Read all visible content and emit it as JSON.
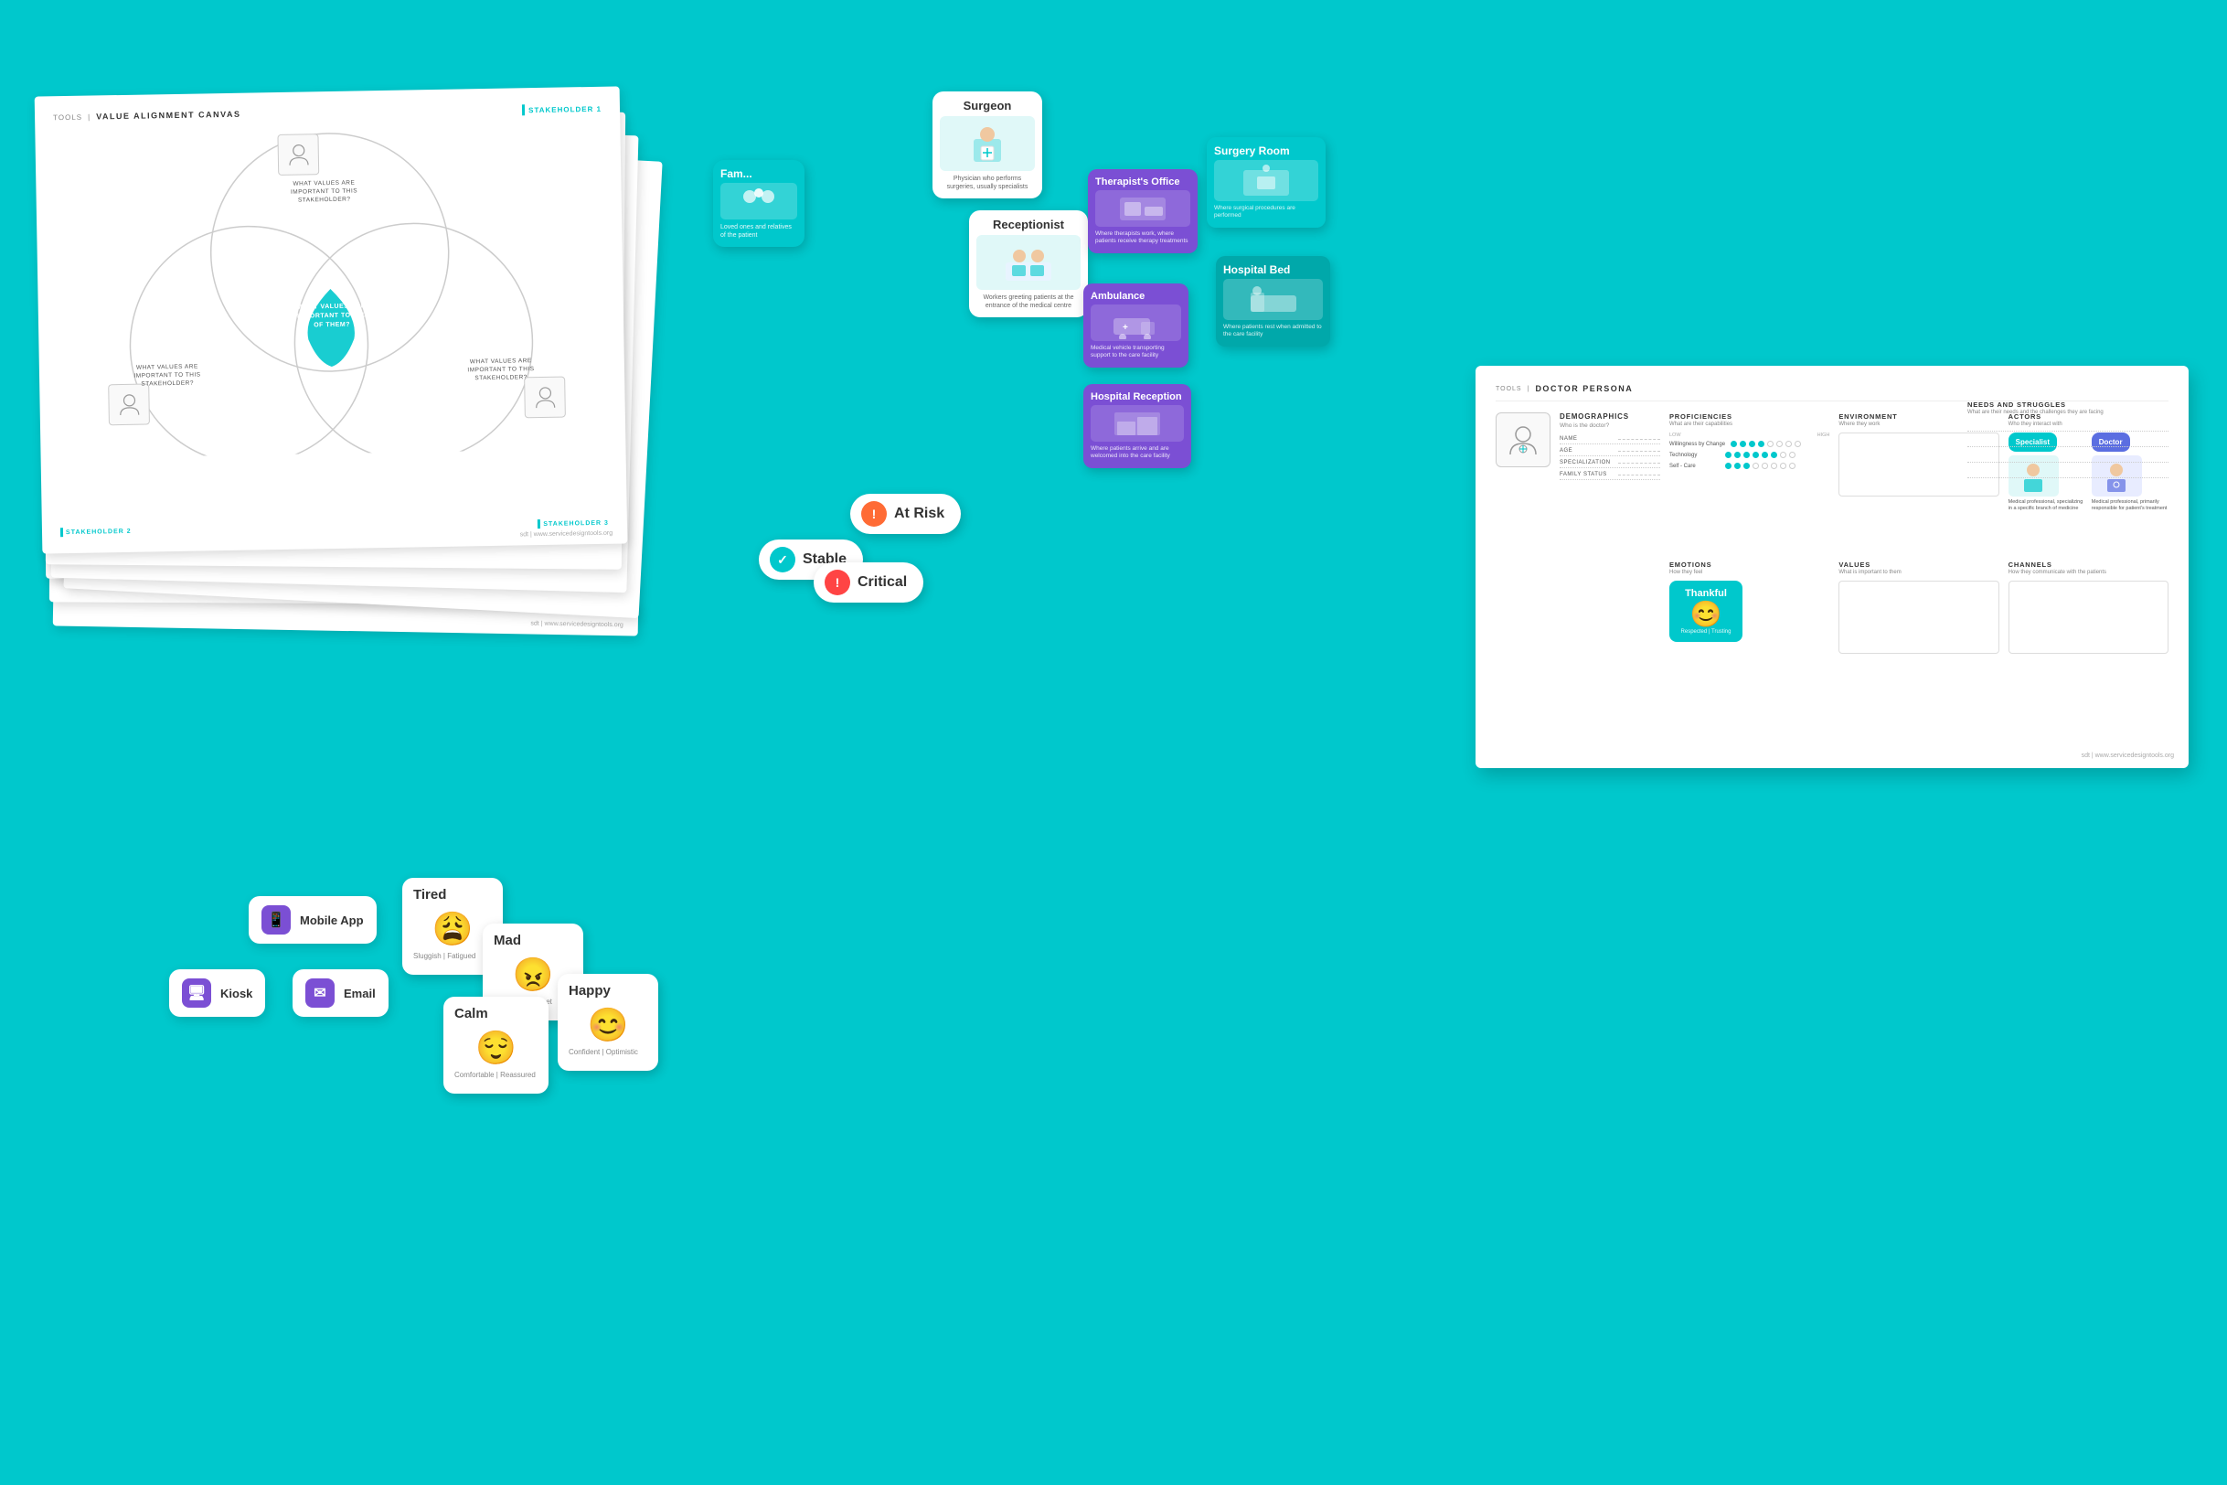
{
  "background": "#00C8CC",
  "canvas": {
    "tools_label": "TOOLS",
    "separator": "|",
    "title": "VALUE ALIGNMENT CANVAS",
    "stakeholder1": "STAKEHOLDER 1",
    "stakeholder2": "STAKEHOLDER 2",
    "stakeholder3": "STAKEHOLDER 3",
    "center_question": "WHAT VALUES ARE IMPORTANT TO ALL OF THEM?",
    "q_top": "WHAT VALUES ARE IMPORTANT TO THIS STAKEHOLDER?",
    "q_left": "WHAT VALUES ARE IMPORTANT TO THIS STAKEHOLDER?",
    "q_right": "WHAT VALUES ARE IMPORTANT TO THIS STAKEHOLDER?",
    "footer": "sdt  |  www.servicedesigntools.org"
  },
  "strips": [
    {
      "footer": "sdt  |  www.servicedesigntools.org"
    },
    {
      "footer": "sdt  |  www.servicedesigntools.org"
    },
    {
      "footer": "sdt  |  www.servicedesigntools.org"
    }
  ],
  "status_cards": {
    "stable": {
      "label": "Stable",
      "icon": "✓"
    },
    "at_risk": {
      "label": "At Risk",
      "icon": "!"
    },
    "critical": {
      "label": "Critical",
      "icon": "!"
    }
  },
  "person_cards": {
    "surgeon": {
      "title": "Surgeon",
      "desc": "Physician who performs surgeries, usually specialists"
    },
    "receptionist": {
      "title": "Receptionist",
      "desc": "Workers greeting patients at the entrance of the medical centre"
    },
    "family": {
      "title": "Fam...",
      "desc": "Loved ones and relatives of the patient"
    }
  },
  "location_cards": {
    "therapist": {
      "title": "Therapist's Office",
      "desc": "Where therapists work, where patients receive therapy treatments"
    },
    "ambulance": {
      "title": "Ambulance",
      "desc": "Medical vehicle transporting support to the care facility"
    },
    "hospital_reception": {
      "title": "Hospital Reception",
      "desc": "Where patients arrive and are welcomed into the care facility"
    }
  },
  "surgery_cards": {
    "surgery_room": {
      "title": "Surgery Room",
      "desc": "Where surgical procedures are performed"
    },
    "hospital_bed": {
      "title": "Hospital Bed",
      "desc": "Where patients rest when admitted to the care facility"
    }
  },
  "channels": {
    "mobile_app": {
      "label": "Mobile App",
      "icon": "📱"
    },
    "kiosk": {
      "label": "Kiosk",
      "icon": "🖥"
    },
    "email": {
      "label": "Email",
      "icon": "✉"
    }
  },
  "emotions": {
    "tired": {
      "title": "Tired",
      "subtitle": "Sluggish | Fatigued",
      "face": "😩"
    },
    "mad": {
      "title": "Mad",
      "subtitle": "Frustrated | Upset",
      "face": "😠"
    },
    "calm": {
      "title": "Calm",
      "subtitle": "Comfortable | Reassured",
      "face": "😌"
    },
    "happy": {
      "title": "Happy",
      "subtitle": "Confident | Optimistic",
      "face": "😊"
    }
  },
  "persona": {
    "tools_label": "TOOLS",
    "separator": "|",
    "title": "DOCTOR PERSONA",
    "demographics": {
      "section_title": "DEMOGRAPHICS",
      "subtitle": "Who is the doctor?",
      "fields": {
        "name": "NAME",
        "age": "AGE",
        "specialization": "SPECIALIZATION",
        "family_status": "FAMILY STATUS"
      }
    },
    "needs": {
      "section_title": "NEEDS AND STRUGGLES",
      "subtitle": "What are their needs and the challenges they are facing"
    },
    "proficiencies": {
      "section_title": "PROFICIENCIES",
      "subtitle": "What are their capabilities",
      "low": "LOW",
      "high": "HIGH",
      "items": [
        {
          "label": "Willingness by Change",
          "filled": 4
        },
        {
          "label": "Technology",
          "filled": 6
        },
        {
          "label": "Self - Care",
          "filled": 3
        }
      ],
      "total_dots": 8
    },
    "environment": {
      "section_title": "ENVIRONMENT",
      "subtitle": "Where they work"
    },
    "actors": {
      "section_title": "ACTORS",
      "subtitle": "Who they interact with",
      "specialist": {
        "label": "Specialist",
        "desc": "Medical professional, specializing in a specific branch of medicine"
      },
      "doctor": {
        "label": "Doctor",
        "desc": "Medical professional, primarily responsible for patient's treatment"
      }
    },
    "emotions": {
      "section_title": "EMOTIONS",
      "subtitle": "How they feel",
      "thankful": {
        "title": "Thankful",
        "subtitle": "Respected | Trusting",
        "face": "😊"
      }
    },
    "values": {
      "section_title": "VALUES",
      "subtitle": "What is important to them"
    },
    "channels": {
      "section_title": "CHANNELS",
      "subtitle": "How they communicate with the patients"
    },
    "footer": "sdt  |  www.servicedesigntools.org"
  }
}
